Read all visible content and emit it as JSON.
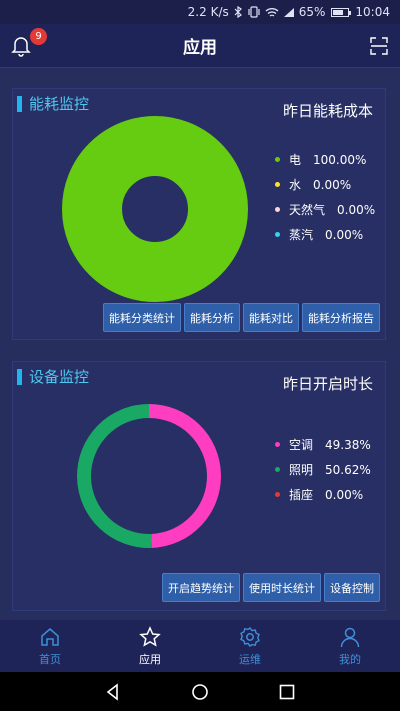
{
  "status": {
    "speed": "2.2 K/s",
    "battery": "65%",
    "time": "10:04",
    "battery_level": 0.65
  },
  "header": {
    "title": "应用",
    "badge": "9"
  },
  "energy": {
    "section_title": "能耗监控",
    "chart_title": "昨日能耗成本",
    "legend": [
      {
        "name": "电",
        "value": "100.00%",
        "color": "#66cc11"
      },
      {
        "name": "水",
        "value": "0.00%",
        "color": "#ffe033"
      },
      {
        "name": "天然气",
        "value": "0.00%",
        "color": "#ffd6d6"
      },
      {
        "name": "蒸汽",
        "value": "0.00%",
        "color": "#33d6ee"
      }
    ],
    "buttons": [
      "能耗分类统计",
      "能耗分析",
      "能耗对比",
      "能耗分析报告"
    ]
  },
  "device": {
    "section_title": "设备监控",
    "chart_title": "昨日开启时长",
    "legend": [
      {
        "name": "空调",
        "value": "49.38%",
        "color": "#ff3dc1"
      },
      {
        "name": "照明",
        "value": "50.62%",
        "color": "#1aa865"
      },
      {
        "name": "插座",
        "value": "0.00%",
        "color": "#e53935"
      }
    ],
    "buttons": [
      "开启趋势统计",
      "使用时长统计",
      "设备控制"
    ]
  },
  "chart_data": [
    {
      "type": "pie",
      "title": "昨日能耗成本",
      "categories": [
        "电",
        "水",
        "天然气",
        "蒸汽"
      ],
      "values": [
        100.0,
        0.0,
        0.0,
        0.0
      ],
      "colors": [
        "#66cc11",
        "#ffe033",
        "#ffd6d6",
        "#33d6ee"
      ]
    },
    {
      "type": "pie",
      "title": "昨日开启时长",
      "categories": [
        "空调",
        "照明",
        "插座"
      ],
      "values": [
        49.38,
        50.62,
        0.0
      ],
      "colors": [
        "#ff3dc1",
        "#1aa865",
        "#e53935"
      ]
    }
  ],
  "tabs": [
    {
      "label": "首页",
      "icon": "home-icon"
    },
    {
      "label": "应用",
      "icon": "star-icon",
      "active": true
    },
    {
      "label": "运维",
      "icon": "gear-icon"
    },
    {
      "label": "我的",
      "icon": "user-icon"
    }
  ]
}
